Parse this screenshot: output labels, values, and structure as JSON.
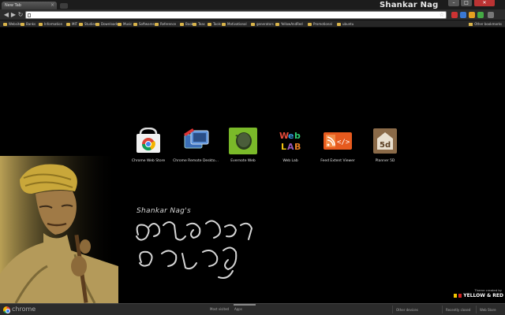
{
  "tab": {
    "title": "New Tab"
  },
  "window": {
    "title": "Shankar Nag"
  },
  "omnibox": {
    "value": "",
    "placeholder": ""
  },
  "bookmarks": [
    "Website",
    "Banks",
    "Information",
    "MIT",
    "Studies",
    "Downloads",
    "Music",
    "Softwares",
    "Reference",
    "Books",
    "Teas",
    "Tools",
    "Motivational",
    "generators",
    "YellowAndRed",
    "Promotional",
    "ubuntu"
  ],
  "bookmarks_other": "Other bookmarks",
  "apps": [
    {
      "label": "Chrome Web Store",
      "icon": "chrome-web-store-icon"
    },
    {
      "label": "Chrome Remote Deskto...",
      "icon": "chrome-remote-desktop-icon"
    },
    {
      "label": "Evernote Web",
      "icon": "evernote-icon"
    },
    {
      "label": "Web Lab",
      "icon": "web-lab-icon"
    },
    {
      "label": "Feed Extent Viewer",
      "icon": "feed-viewer-icon"
    },
    {
      "label": "Planner 5D",
      "icon": "planner-5d-icon"
    }
  ],
  "caption": {
    "name": "Shankar Nag's"
  },
  "credit": {
    "small": "Theme created by",
    "brand": "YELLOW & RED"
  },
  "bottom": {
    "brand": "chrome",
    "most_visited": "Most visited",
    "apps": "Apps",
    "other_devices": "Other devices",
    "recently_closed": "Recently closed",
    "web_store": "Web Store"
  },
  "colors": {
    "yellow": "#f2c500",
    "red": "#d32222",
    "background": "#000000"
  }
}
